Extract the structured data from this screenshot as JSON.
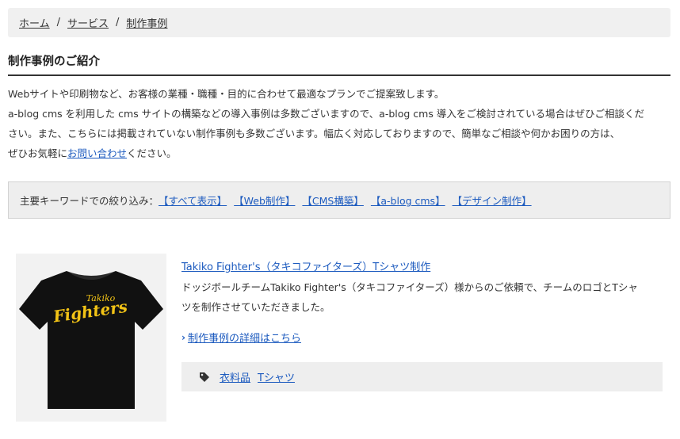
{
  "breadcrumb": {
    "items": [
      "ホーム",
      "サービス",
      "制作事例"
    ],
    "separator": "/"
  },
  "section": {
    "title": "制作事例のご紹介"
  },
  "intro": {
    "line1": "Webサイトや印刷物など、お客様の業種・職種・目的に合わせて最適なプランでご提案致します。",
    "line2": "a-blog cms を利用した cms サイトの構築などの導入事例は多数ございますので、a-blog cms 導入をご検討されている場合はぜひご相談くだ",
    "line3": "さい。また、こちらには掲載されていない制作事例も多数ございます。幅広く対応しておりますので、簡単なご相談や何かお困りの方は、",
    "line4_pre": "ぜひお気軽に",
    "line4_link": "お問い合わせ",
    "line4_post": "ください。"
  },
  "filter": {
    "label": "主要キーワードでの絞り込み：",
    "keywords": [
      "【すべて表示】",
      "【Web制作】",
      "【CMS構築】",
      "【a-blog cms】",
      "【デザイン制作】"
    ]
  },
  "case": {
    "title": "Takiko Fighter's（タキコファイターズ）Tシャツ制作",
    "desc_line1": "ドッジボールチームTakiko Fighter's（タキコファイターズ）様からのご依頼で、チームのロゴとTシャ",
    "desc_line2": "ツを制作させていただきました。",
    "more_chevron": "›",
    "more_link": "制作事例の詳細はこちら",
    "image": {
      "logo_top": "Takiko",
      "logo_main": "Fighters",
      "shirt_color": "#111111",
      "logo_color": "#f2c316"
    },
    "tags": [
      "衣料品",
      "Tシャツ"
    ]
  },
  "colors": {
    "link": "#1d5bbf",
    "panel_bg": "#eeeeee",
    "text": "#333333"
  }
}
